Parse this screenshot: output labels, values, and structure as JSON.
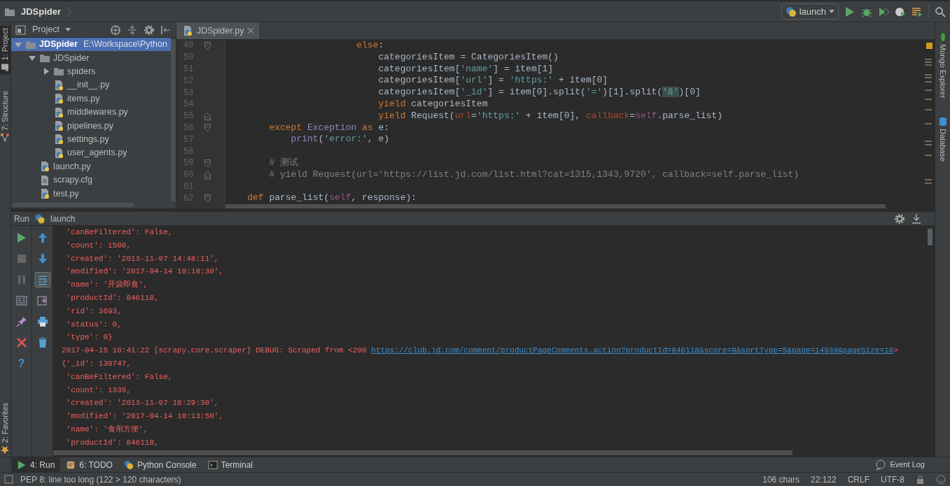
{
  "breadcrumb": {
    "label": "JDSpider"
  },
  "run_config": {
    "label": "launch"
  },
  "left_tool_tabs": [
    {
      "label": "1: Project",
      "kind": "project",
      "selected": true
    },
    {
      "label": "7: Structure",
      "kind": "structure",
      "selected": false
    },
    {
      "label": "2: Favorites",
      "kind": "favorites",
      "selected": false
    }
  ],
  "right_tool_tabs": [
    {
      "label": "Mongo Explorer",
      "kind": "mongo"
    },
    {
      "label": "Database",
      "kind": "database"
    }
  ],
  "project_panel": {
    "title": "Project",
    "tree": [
      {
        "name": "JDSpider",
        "path": "E:\\Workspace\\Python",
        "kind": "folder",
        "expanded": true,
        "selected": true,
        "children": [
          {
            "name": "JDSpider",
            "kind": "folder",
            "expanded": true,
            "selected": false,
            "children": [
              {
                "name": "spiders",
                "kind": "folder",
                "expanded": false,
                "selected": false
              },
              {
                "name": "__init__.py",
                "kind": "python",
                "selected": false
              },
              {
                "name": "items.py",
                "kind": "python",
                "selected": false
              },
              {
                "name": "middlewares.py",
                "kind": "python",
                "selected": false
              },
              {
                "name": "pipelines.py",
                "kind": "python",
                "selected": false
              },
              {
                "name": "settings.py",
                "kind": "python",
                "selected": false
              },
              {
                "name": "user_agents.py",
                "kind": "python",
                "selected": false
              }
            ]
          },
          {
            "name": "launch.py",
            "kind": "python",
            "selected": false
          },
          {
            "name": "scrapy.cfg",
            "kind": "file",
            "selected": false
          },
          {
            "name": "test.py",
            "kind": "python",
            "selected": false
          }
        ]
      }
    ]
  },
  "editor": {
    "tabs": [
      {
        "label": "JDSpider.py",
        "selected": true
      }
    ],
    "lines": [
      {
        "number": "49",
        "fold_start": true,
        "fold_end": false,
        "tokens": [
          {
            "text": "                        else",
            "kind": "keyword"
          },
          {
            "text": ":",
            "kind": "plain"
          }
        ]
      },
      {
        "number": "50",
        "fold_start": false,
        "fold_end": false,
        "tokens": [
          {
            "text": "                            categoriesItem = CategoriesItem()",
            "kind": "plain"
          }
        ]
      },
      {
        "number": "51",
        "fold_start": false,
        "fold_end": false,
        "tokens": [
          {
            "text": "                            categoriesItem[",
            "kind": "plain"
          },
          {
            "text": "'name'",
            "kind": "string"
          },
          {
            "text": "] = item[1]",
            "kind": "plain"
          }
        ]
      },
      {
        "number": "52",
        "fold_start": false,
        "fold_end": false,
        "tokens": [
          {
            "text": "                            categoriesItem[",
            "kind": "plain"
          },
          {
            "text": "'url'",
            "kind": "string"
          },
          {
            "text": "] = ",
            "kind": "plain"
          },
          {
            "text": "'https:'",
            "kind": "string"
          },
          {
            "text": " + item[0]",
            "kind": "plain"
          }
        ]
      },
      {
        "number": "53",
        "fold_start": false,
        "fold_end": false,
        "tokens": [
          {
            "text": "                            categoriesItem[",
            "kind": "plain"
          },
          {
            "text": "'_id'",
            "kind": "string"
          },
          {
            "text": "] = item[0].split(",
            "kind": "plain"
          },
          {
            "text": "'='",
            "kind": "string"
          },
          {
            "text": ")[1].split(",
            "kind": "plain"
          },
          {
            "text": "'&'",
            "kind": "string-hl"
          },
          {
            "text": ")[0]",
            "kind": "plain"
          }
        ]
      },
      {
        "number": "54",
        "fold_start": false,
        "fold_end": false,
        "tokens": [
          {
            "text": "                            yield",
            "kind": "keyword"
          },
          {
            "text": " categoriesItem",
            "kind": "plain"
          }
        ]
      },
      {
        "number": "55",
        "fold_start": false,
        "fold_end": true,
        "tokens": [
          {
            "text": "                            yield",
            "kind": "keyword"
          },
          {
            "text": " Request(",
            "kind": "plain"
          },
          {
            "text": "url",
            "kind": "param"
          },
          {
            "text": "=",
            "kind": "plain"
          },
          {
            "text": "'https:'",
            "kind": "string"
          },
          {
            "text": " + item[0], ",
            "kind": "plain"
          },
          {
            "text": "callback",
            "kind": "param"
          },
          {
            "text": "=",
            "kind": "plain"
          },
          {
            "text": "self",
            "kind": "self"
          },
          {
            "text": ".parse_list)",
            "kind": "plain"
          }
        ]
      },
      {
        "number": "56",
        "fold_start": true,
        "fold_end": false,
        "tokens": [
          {
            "text": "        except",
            "kind": "keyword"
          },
          {
            "text": " Exception",
            "kind": "builtin"
          },
          {
            "text": " as",
            "kind": "keyword"
          },
          {
            "text": " e:",
            "kind": "plain"
          }
        ]
      },
      {
        "number": "57",
        "fold_start": false,
        "fold_end": false,
        "tokens": [
          {
            "text": "            print",
            "kind": "builtin"
          },
          {
            "text": "(",
            "kind": "plain"
          },
          {
            "text": "'error:'",
            "kind": "string"
          },
          {
            "text": ", e)",
            "kind": "plain"
          }
        ]
      },
      {
        "number": "58",
        "fold_start": false,
        "fold_end": false
      },
      {
        "number": "59",
        "fold_start": true,
        "fold_end": false,
        "tokens": [
          {
            "text": "        # 测试",
            "kind": "comment"
          }
        ]
      },
      {
        "number": "60",
        "fold_start": false,
        "fold_end": true,
        "tokens": [
          {
            "text": "        # yield Request(url='https://list.jd.com/list.html?cat=1315,1343,9720', callback=self.parse_list)",
            "kind": "comment"
          }
        ]
      },
      {
        "number": "61",
        "fold_start": false,
        "fold_end": false
      },
      {
        "number": "62",
        "fold_start": true,
        "fold_end": false,
        "tokens": [
          {
            "text": "    def",
            "kind": "keyword"
          },
          {
            "text": " parse_list(",
            "kind": "plain"
          },
          {
            "text": "self",
            "kind": "self"
          },
          {
            "text": ", response):",
            "kind": "plain"
          }
        ]
      }
    ]
  },
  "run_panel": {
    "title": "Run",
    "config": "launch",
    "help_label": "?",
    "output": [
      {
        "text": " 'canBeFiltered': False,"
      },
      {
        "text": " 'count': 1500,"
      },
      {
        "text": " 'created': '2013-11-07 14:48:11',"
      },
      {
        "text": " 'modified': '2017-04-14 10:18:30',"
      },
      {
        "text": " 'name': '开袋即食',"
      },
      {
        "text": " 'productId': 846118,"
      },
      {
        "text": " 'rid': 3693,"
      },
      {
        "text": " 'status': 0,"
      },
      {
        "text": " 'type': 0}"
      },
      {
        "text": "2017-04-15 10:41:22 [scrapy.core.scraper] DEBUG: Scraped from <200 ",
        "link": "https://club.jd.com/comment/productPageComments.action?productId=846118&score=0&sortType=5&page=14939&pageSize=10",
        "after": ">"
      },
      {
        "text": "{'_id': 130747,"
      },
      {
        "text": " 'canBeFiltered': False,"
      },
      {
        "text": " 'count': 1335,"
      },
      {
        "text": " 'created': '2013-11-07 18:29:30',"
      },
      {
        "text": " 'modified': '2017-04-14 10:13:50',"
      },
      {
        "text": " 'name': '食用方便',"
      },
      {
        "text": " 'productId': 846118,"
      }
    ]
  },
  "bottom_tabs": [
    {
      "label": "4: Run",
      "kind": "run",
      "selected": true
    },
    {
      "label": "6: TODO",
      "kind": "todo",
      "selected": false
    },
    {
      "label": "Python Console",
      "kind": "python",
      "selected": false
    },
    {
      "label": "Terminal",
      "kind": "terminal",
      "selected": false
    }
  ],
  "event_log": {
    "label": "Event Log"
  },
  "status_bar": {
    "message": "PEP 8: line too long (122 > 120 characters)",
    "items": [
      "106 chars",
      "22:122",
      "CRLF",
      "UTF-8"
    ]
  }
}
